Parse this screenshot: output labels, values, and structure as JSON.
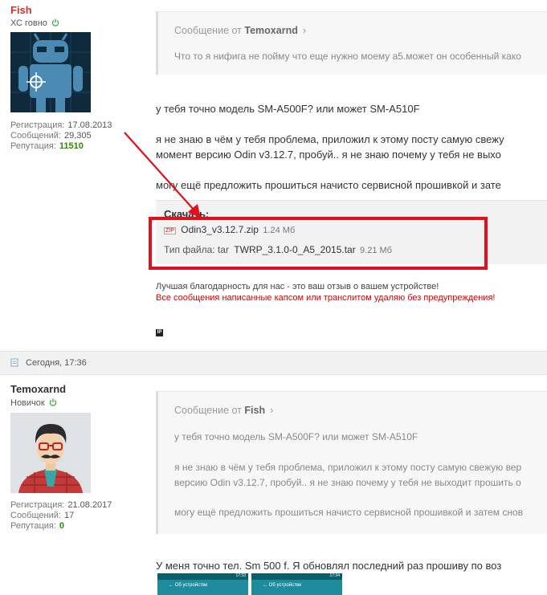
{
  "post1": {
    "username": "Fish",
    "user_title": "ХС говно",
    "stats": [
      {
        "label": "Регистрация:",
        "value": "17.08.2013"
      },
      {
        "label": "Сообщений:",
        "value": "29,305"
      },
      {
        "label": "Репутация:",
        "value": "11510"
      }
    ],
    "quote": {
      "prefix": "Сообщение от",
      "author": "Temoxarnd",
      "text": "Что то я нифига не пойму что еще нужно моему а5.может он особенный како"
    },
    "body_lines": [
      "у тебя точно модель SM-A500F? или может SM-A510F",
      "я не знаю в чём у тебя проблема, приложил к этому посту самую свежу",
      "момент версию Odin v3.12.7, пробуй.. я не знаю почему у тебя не выхо",
      "могу ещё предложить прошиться начисто сервисной прошивкой и зате"
    ],
    "download": {
      "title": "Скачать:",
      "file1": {
        "badge": "ZIP",
        "name": "Odin3_v3.12.7.zip",
        "size": "1.24 Мб"
      },
      "file2": {
        "prefix": "Тип файла: tar",
        "name": "TWRP_3.1.0-0_A5_2015.tar",
        "size": "9.21 Мб"
      }
    },
    "signature": {
      "line1": "Лучшая благодарность для нас - это ваш отзыв о вашем устройстве!",
      "line2": "Все сообщения написанные капсом или транслитом удаляю без предупреждения!"
    },
    "ip_badge": "IP"
  },
  "post2": {
    "date": "Сегодня, 17:36",
    "username": "Temoxarnd",
    "user_title": "Новичок",
    "stats": [
      {
        "label": "Регистрация:",
        "value": "21.08.2017"
      },
      {
        "label": "Сообщений:",
        "value": "17"
      },
      {
        "label": "Репутация:",
        "value": "0"
      }
    ],
    "quote": {
      "prefix": "Сообщение от",
      "author": "Fish",
      "lines": [
        "у тебя точно модель SM-A500F? или может SM-A510F",
        "я не знаю в чём у тебя проблема, приложил к этому посту самую свежую вер",
        "версию Odin v3.12.7, пробуй.. я не знаю почему у тебя не выходит прошить о",
        "могу ещё предложить прошиться начисто сервисной прошивкой и затем снов"
      ]
    },
    "body_line": "У меня точно тел. Sm 500 f. Я обновлял последний раз прошиву по воз",
    "thumbs": [
      {
        "label": "← Об устройстве",
        "time": "17:33"
      },
      {
        "label": "← Об устройстве",
        "time": "17:34"
      }
    ]
  },
  "colors": {
    "username_red": "#d62e2e",
    "reputation_green": "#2e8b00",
    "power_icon": "#4cae4c",
    "annotation_red": "#e0101c",
    "signature_red": "#dd0000"
  }
}
